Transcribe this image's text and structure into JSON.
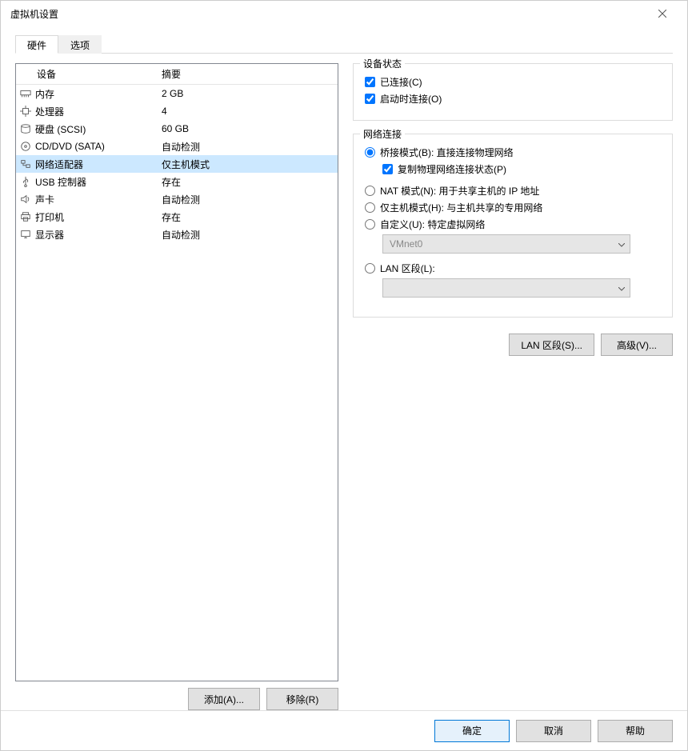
{
  "window": {
    "title": "虚拟机设置"
  },
  "tabs": {
    "hardware": "硬件",
    "options": "选项"
  },
  "list": {
    "header_device": "设备",
    "header_summary": "摘要",
    "items": [
      {
        "icon": "memory",
        "name": "内存",
        "summary": "2 GB"
      },
      {
        "icon": "cpu",
        "name": "处理器",
        "summary": "4"
      },
      {
        "icon": "disk",
        "name": "硬盘 (SCSI)",
        "summary": "60 GB"
      },
      {
        "icon": "cd",
        "name": "CD/DVD (SATA)",
        "summary": "自动检测"
      },
      {
        "icon": "network",
        "name": "网络适配器",
        "summary": "仅主机模式"
      },
      {
        "icon": "usb",
        "name": "USB 控制器",
        "summary": "存在"
      },
      {
        "icon": "sound",
        "name": "声卡",
        "summary": "自动检测"
      },
      {
        "icon": "printer",
        "name": "打印机",
        "summary": "存在"
      },
      {
        "icon": "display",
        "name": "显示器",
        "summary": "自动检测"
      }
    ],
    "selected_index": 4
  },
  "left_buttons": {
    "add": "添加(A)...",
    "remove": "移除(R)"
  },
  "device_state": {
    "legend": "设备状态",
    "connected": "已连接(C)",
    "connect_at_poweron": "启动时连接(O)"
  },
  "network": {
    "legend": "网络连接",
    "bridged": "桥接模式(B): 直接连接物理网络",
    "replicate": "复制物理网络连接状态(P)",
    "nat": "NAT 模式(N): 用于共享主机的 IP 地址",
    "hostonly": "仅主机模式(H): 与主机共享的专用网络",
    "custom": "自定义(U): 特定虚拟网络",
    "custom_value": "VMnet0",
    "lanseg": "LAN 区段(L):",
    "lanseg_value": ""
  },
  "right_buttons": {
    "lan": "LAN 区段(S)...",
    "advanced": "高级(V)..."
  },
  "footer": {
    "ok": "确定",
    "cancel": "取消",
    "help": "帮助"
  }
}
